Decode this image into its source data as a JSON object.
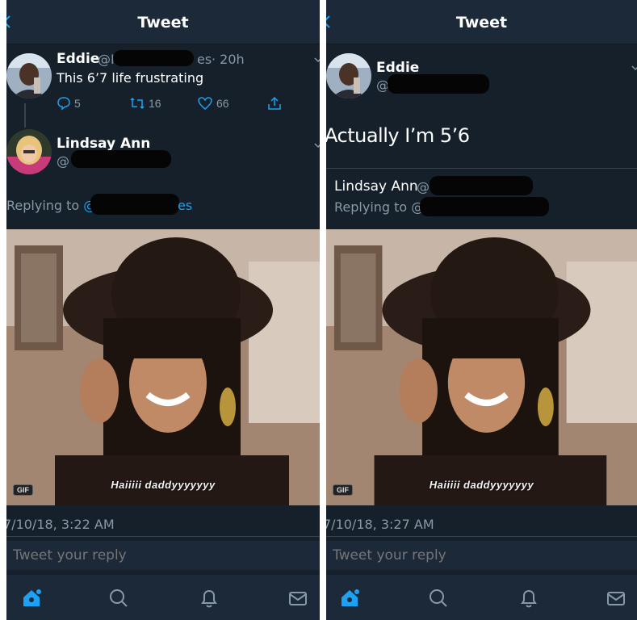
{
  "left": {
    "header": {
      "title": "Tweet"
    },
    "tweet1": {
      "name": "Eddie",
      "handle_prefix": "@H",
      "handle_suffix": "es",
      "time": "· 20h",
      "text": "This 6’7 life frustrating",
      "replies": "5",
      "retweets": "16",
      "likes": "66"
    },
    "tweet2": {
      "name": "Lindsay Ann",
      "handle_prefix": "@",
      "replying_label": "Replying to",
      "replying_prefix": "@",
      "replying_suffix": "es"
    },
    "media": {
      "badge": "GIF",
      "caption": "Haiiiii daddyyyyyyy"
    },
    "timestamp": "7/10/18, 3:22 AM",
    "reply_placeholder": "Tweet your reply"
  },
  "right": {
    "header": {
      "title": "Tweet"
    },
    "tweet1": {
      "name": "Eddie",
      "handle_prefix": "@H",
      "text": "Actually I’m 5’6"
    },
    "tweet2": {
      "name": "Lindsay Ann",
      "handle_prefix": "@s",
      "replying_label": "Replying to",
      "replying_prefix": "@"
    },
    "media": {
      "badge": "GIF",
      "caption": "Haiiiii daddyyyyyyy"
    },
    "timestamp": "7/10/18, 3:27 AM",
    "reply_placeholder": "Tweet your reply"
  },
  "colors": {
    "background": "#15202b",
    "header": "#1c2938",
    "accent": "#1da1f2",
    "muted": "#8899a6",
    "divider": "#38444d"
  },
  "icons": {
    "tabs": [
      "home-icon",
      "search-icon",
      "bell-icon",
      "mail-icon"
    ],
    "actions": [
      "reply-icon",
      "retweet-icon",
      "heart-icon",
      "share-icon"
    ]
  }
}
